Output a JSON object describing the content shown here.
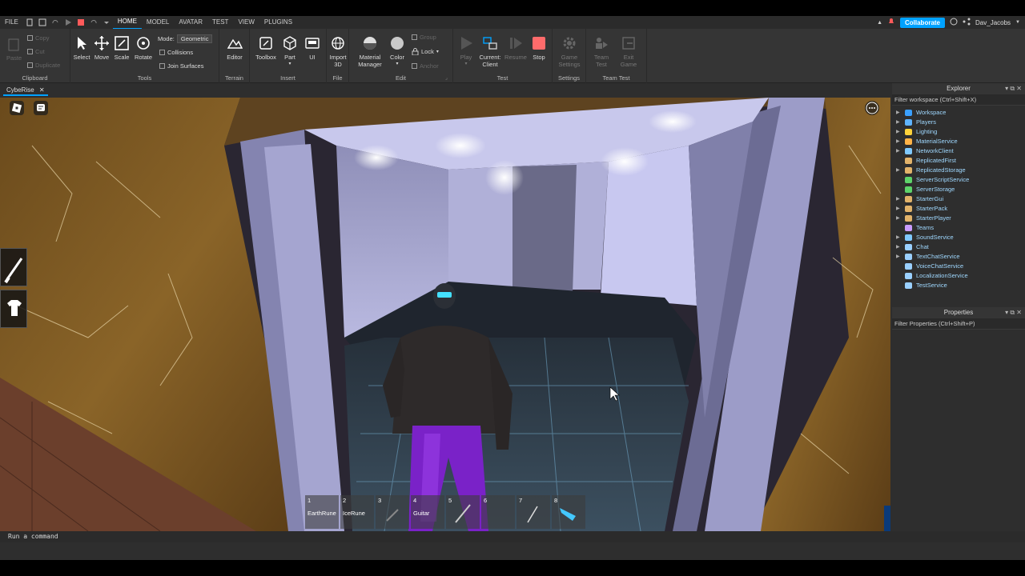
{
  "menu": {
    "file": "FILE",
    "tabs": [
      "HOME",
      "MODEL",
      "AVATAR",
      "TEST",
      "VIEW",
      "PLUGINS"
    ],
    "active_tab": "HOME",
    "collaborate": "Collaborate",
    "user": "Dav_Jacobs"
  },
  "ribbon": {
    "clipboard": {
      "label": "Clipboard",
      "copy": "Copy",
      "paste": "Paste",
      "cut": "Cut",
      "duplicate": "Duplicate"
    },
    "tools": {
      "label": "Tools",
      "select": "Select",
      "move": "Move",
      "scale": "Scale",
      "rotate": "Rotate",
      "mode_label": "Mode:",
      "mode_value": "Geometric",
      "collisions": "Collisions",
      "join_surfaces": "Join Surfaces"
    },
    "terrain": {
      "label": "Terrain",
      "editor": "Editor"
    },
    "insert": {
      "label": "Insert",
      "toolbox": "Toolbox",
      "part": "Part",
      "ui": "UI"
    },
    "file": {
      "label": "File",
      "import": "Import",
      "import2": "3D"
    },
    "edit": {
      "label": "Edit",
      "material": "Material",
      "material2": "Manager",
      "color": "Color",
      "group": "Group",
      "lock": "Lock",
      "anchor": "Anchor"
    },
    "test": {
      "label": "Test",
      "play": "Play",
      "current": "Current:",
      "current2": "Client",
      "resume": "Resume",
      "stop": "Stop"
    },
    "settings": {
      "label": "Settings",
      "game": "Game",
      "game2": "Settings"
    },
    "team_test": {
      "label": "Team Test",
      "team": "Team",
      "team2": "Test",
      "exit": "Exit",
      "exit2": "Game"
    }
  },
  "document_tab": "CybeRise",
  "hotbar": [
    {
      "num": "1",
      "label": "EarthRune"
    },
    {
      "num": "2",
      "label": "IceRune"
    },
    {
      "num": "3",
      "label": ""
    },
    {
      "num": "4",
      "label": "Guitar"
    },
    {
      "num": "5",
      "label": ""
    },
    {
      "num": "6",
      "label": ""
    },
    {
      "num": "7",
      "label": ""
    },
    {
      "num": "8",
      "label": ""
    }
  ],
  "explorer": {
    "title": "Explorer",
    "filter": "Filter workspace (Ctrl+Shift+X)",
    "items": [
      {
        "label": "Workspace",
        "expandable": true,
        "color": "#3aa0ff"
      },
      {
        "label": "Players",
        "expandable": true,
        "color": "#5fb4ff"
      },
      {
        "label": "Lighting",
        "expandable": true,
        "color": "#ffd23a"
      },
      {
        "label": "MaterialService",
        "expandable": true,
        "color": "#ffb347"
      },
      {
        "label": "NetworkClient",
        "expandable": true,
        "color": "#7fc9ff"
      },
      {
        "label": "ReplicatedFirst",
        "expandable": false,
        "color": "#e2b36a"
      },
      {
        "label": "ReplicatedStorage",
        "expandable": true,
        "color": "#e2b36a"
      },
      {
        "label": "ServerScriptService",
        "expandable": false,
        "color": "#5ed36a"
      },
      {
        "label": "ServerStorage",
        "expandable": false,
        "color": "#5ed36a"
      },
      {
        "label": "StarterGui",
        "expandable": true,
        "color": "#e2b36a"
      },
      {
        "label": "StarterPack",
        "expandable": true,
        "color": "#e2b36a"
      },
      {
        "label": "StarterPlayer",
        "expandable": true,
        "color": "#e2b36a"
      },
      {
        "label": "Teams",
        "expandable": false,
        "color": "#c99cff"
      },
      {
        "label": "SoundService",
        "expandable": true,
        "color": "#7fc9ff"
      },
      {
        "label": "Chat",
        "expandable": true,
        "color": "#9ad0ff"
      },
      {
        "label": "TextChatService",
        "expandable": true,
        "color": "#9ad0ff"
      },
      {
        "label": "VoiceChatService",
        "expandable": false,
        "color": "#9ad0ff"
      },
      {
        "label": "LocalizationService",
        "expandable": false,
        "color": "#9ad0ff"
      },
      {
        "label": "TestService",
        "expandable": false,
        "color": "#9ad0ff"
      }
    ]
  },
  "properties": {
    "title": "Properties",
    "filter": "Filter Properties (Ctrl+Shift+P)"
  },
  "command_bar": {
    "placeholder": "Run a command"
  },
  "colors": {
    "accent": "#00a2ff",
    "stop": "#ff5a5a",
    "bg": "#2e2e2e"
  }
}
